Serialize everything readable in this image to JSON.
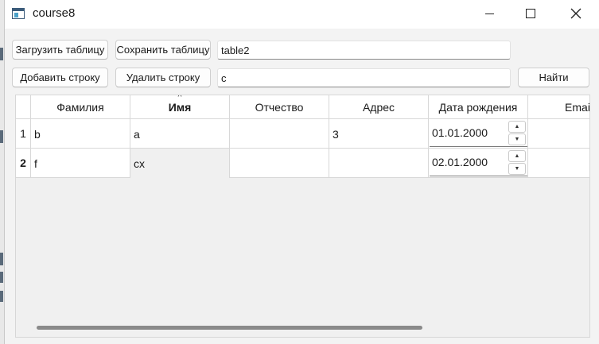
{
  "window": {
    "title": "course8",
    "icon": "app-window-icon",
    "controls": {
      "minimize_icon": "minimize-icon",
      "maximize_icon": "maximize-icon",
      "close_icon": "close-icon"
    }
  },
  "toolbar": {
    "load_label": "Загрузить таблицу",
    "save_label": "Сохранить таблицу",
    "table_name_value": "table2",
    "add_row_label": "Добавить строку",
    "delete_row_label": "Удалить строку",
    "search_value": "c",
    "find_label": "Найти"
  },
  "table": {
    "columns": [
      "Фамилия",
      "Имя",
      "Отчество",
      "Адрес",
      "Дата рождения",
      "Emai"
    ],
    "sorted_column": "Имя",
    "rows": [
      {
        "num": "1",
        "cells": [
          "b",
          "a",
          "",
          "3",
          "01.01.2000",
          ""
        ]
      },
      {
        "num": "2",
        "cells": [
          "f",
          "cx",
          "",
          "",
          "02.01.2000",
          ""
        ]
      }
    ],
    "spin_up_glyph": "▲",
    "spin_down_glyph": "▼",
    "sort_glyph": "^"
  }
}
